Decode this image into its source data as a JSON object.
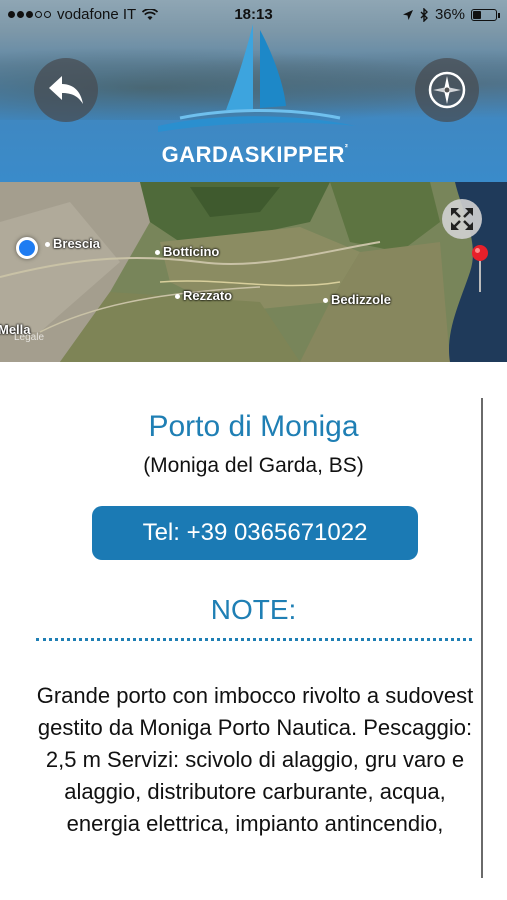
{
  "status_bar": {
    "carrier": "vodafone IT",
    "time": "18:13",
    "battery": "36%",
    "battery_level": 0.36
  },
  "header": {
    "logo_text": "GARDASKIPPER",
    "logo_sup": "²"
  },
  "map": {
    "labels": {
      "brescia": "Brescia",
      "botticino": "Botticino",
      "rezzato": "Rezzato",
      "bedizzole": "Bedizzole",
      "mella": "Mella"
    },
    "legal": "Legale"
  },
  "place": {
    "name": "Porto di Moniga",
    "location": "(Moniga del Garda, BS)",
    "tel_label": "Tel: +39 0365671022"
  },
  "notes": {
    "title": "NOTE:",
    "text": "Grande porto con imbocco rivolto a sudovest gestito da Moniga Porto Nautica. Pescaggio: 2,5 m Servizi: scivolo di alaggio, gru varo e alaggio, distributore carburante, acqua, energia elettrica, impianto antincendio,"
  },
  "colors": {
    "accent": "#1f7fb4",
    "button": "#1b7ab4"
  }
}
